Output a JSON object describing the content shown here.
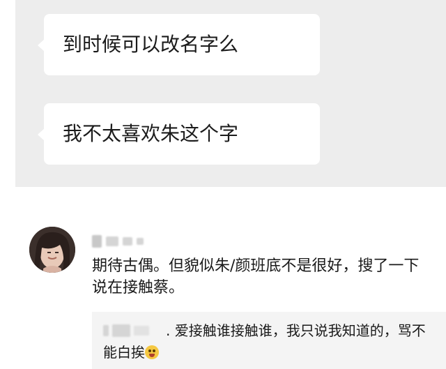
{
  "chat": {
    "messages": [
      {
        "text": "到时候可以改名字么"
      },
      {
        "text": "我不太喜欢朱这个字"
      }
    ],
    "background_color": "#ededed",
    "bubble_color": "#ffffff"
  },
  "comment": {
    "avatar_icon": "user-photo-avatar",
    "text": "期待古偶。但貌似朱/颜班底不是很好，搜了一下说在接触蔡。",
    "reply": {
      "text": ". 爱接触谁接触谁，我只说我知道的，骂不能白挨",
      "emoji_icon": "screaming-face-emoji"
    }
  }
}
